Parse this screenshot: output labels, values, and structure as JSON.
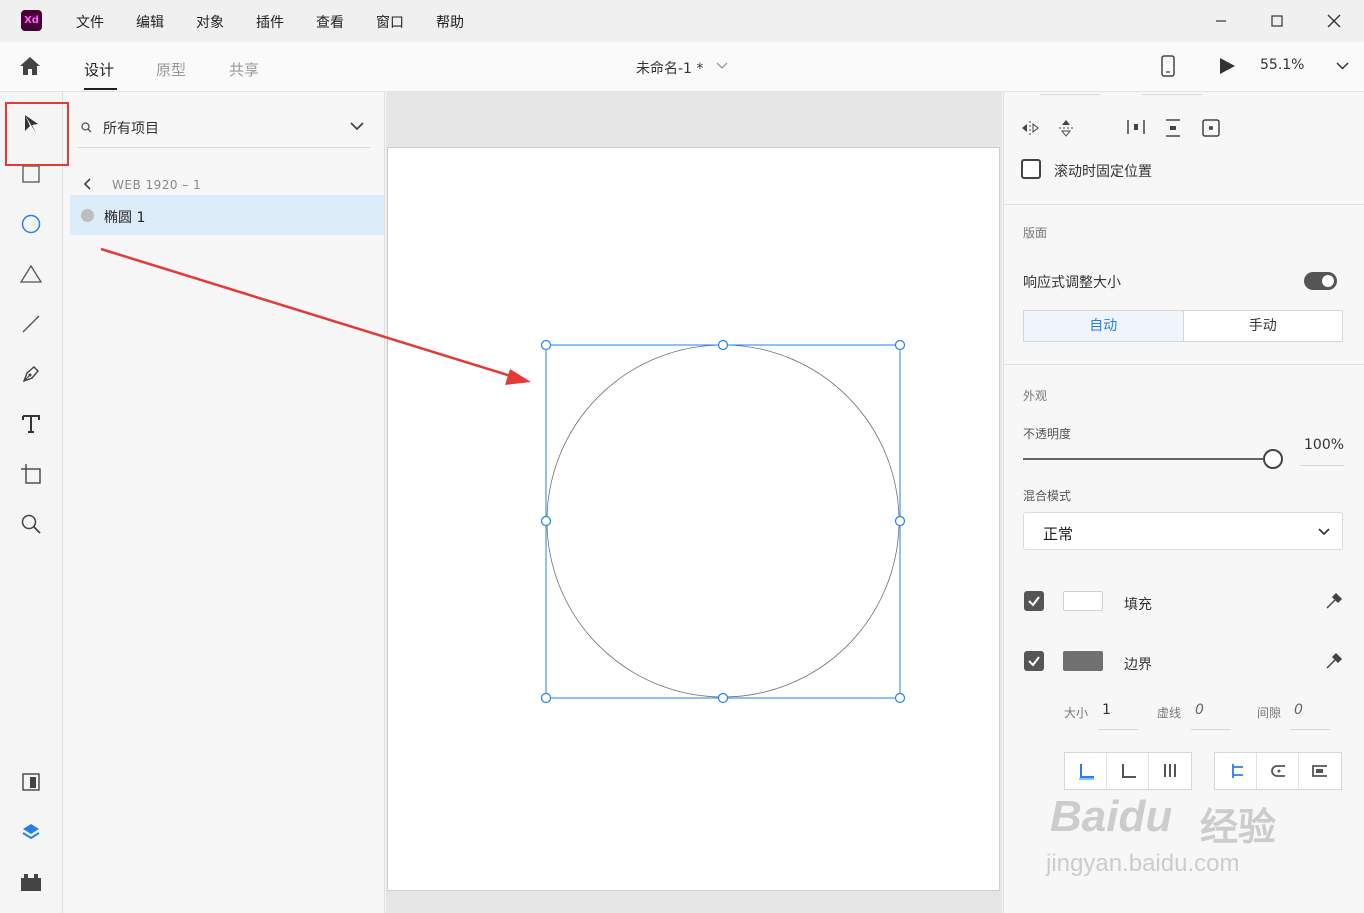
{
  "app": {
    "logo_text": "Xd",
    "brand_color": "#470137",
    "accent_color": "#2680eb",
    "annotation_color": "#e53935"
  },
  "menu": [
    "文件",
    "编辑",
    "对象",
    "插件",
    "查看",
    "窗口",
    "帮助"
  ],
  "toolbar": {
    "tabs": [
      "设计",
      "原型",
      "共享"
    ],
    "active_tab": "设计",
    "document_title": "未命名-1 *",
    "zoom": "55.1%"
  },
  "tools": [
    "select-tool",
    "rectangle-tool",
    "ellipse-tool",
    "polygon-tool",
    "line-tool",
    "pen-tool",
    "text-tool",
    "artboard-tool",
    "zoom-tool",
    "assets-icon",
    "layers-icon",
    "plugins-icon"
  ],
  "active_tool": "ellipse-tool",
  "layers": {
    "filter_label": "所有项目",
    "breadcrumb": "WEB 1920 – 1",
    "items": [
      {
        "label": "椭圆 1",
        "selected": true
      }
    ]
  },
  "properties": {
    "fix_position_label": "滚动时固定位置",
    "layout": {
      "title": "版面",
      "responsive_label": "响应式调整大小",
      "responsive_on": true,
      "auto_label": "自动",
      "manual_label": "手动"
    },
    "appearance": {
      "title": "外观",
      "opacity_label": "不透明度",
      "opacity_value": "100%",
      "opacity": 1.0,
      "blend_label": "混合模式",
      "blend_value": "正常"
    },
    "fill": {
      "label": "填充",
      "enabled": true,
      "color": "#ffffff"
    },
    "border": {
      "label": "边界",
      "enabled": true,
      "color": "#707070",
      "size_label": "大小",
      "size_value": "1",
      "dash_label": "虚线",
      "dash_value": "0",
      "gap_label": "间隙",
      "gap_value": "0"
    }
  },
  "watermark": {
    "brand": "Baidu",
    "cn": "经验",
    "url": "jingyan.baidu.com"
  }
}
